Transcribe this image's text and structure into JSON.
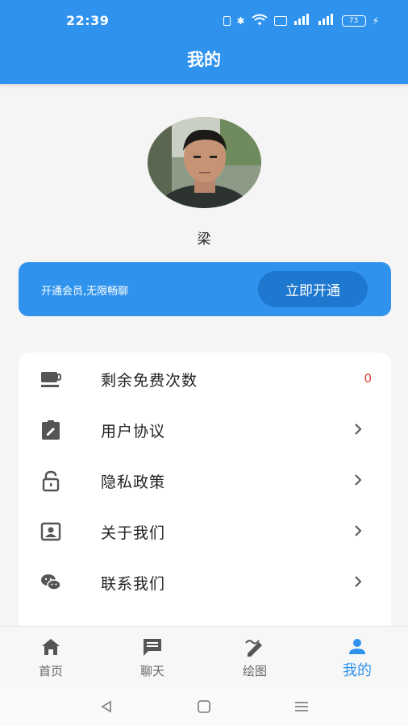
{
  "status_bar": {
    "time": "22:39",
    "battery": "73"
  },
  "header": {
    "title": "我的"
  },
  "profile": {
    "name": "梁"
  },
  "vip": {
    "text": "开通会员,无限畅聊",
    "button_label": "立即开通"
  },
  "menu": [
    {
      "label": "剩余免费次数",
      "value": "0",
      "icon": "cup-icon"
    },
    {
      "label": "用户协议",
      "icon": "edit-clipboard-icon"
    },
    {
      "label": "隐私政策",
      "icon": "lock-icon"
    },
    {
      "label": "关于我们",
      "icon": "id-card-icon"
    },
    {
      "label": "联系我们",
      "icon": "wechat-icon"
    }
  ],
  "bottom_nav": [
    {
      "label": "首页",
      "icon": "home-icon",
      "active": false
    },
    {
      "label": "聊天",
      "icon": "chat-icon",
      "active": false
    },
    {
      "label": "绘图",
      "icon": "draw-icon",
      "active": false
    },
    {
      "label": "我的",
      "icon": "person-icon",
      "active": true
    }
  ],
  "colors": {
    "primary": "#2f93ee",
    "primary_dark": "#1e78cf",
    "counter": "#e53935",
    "background": "#f5f5f5"
  }
}
